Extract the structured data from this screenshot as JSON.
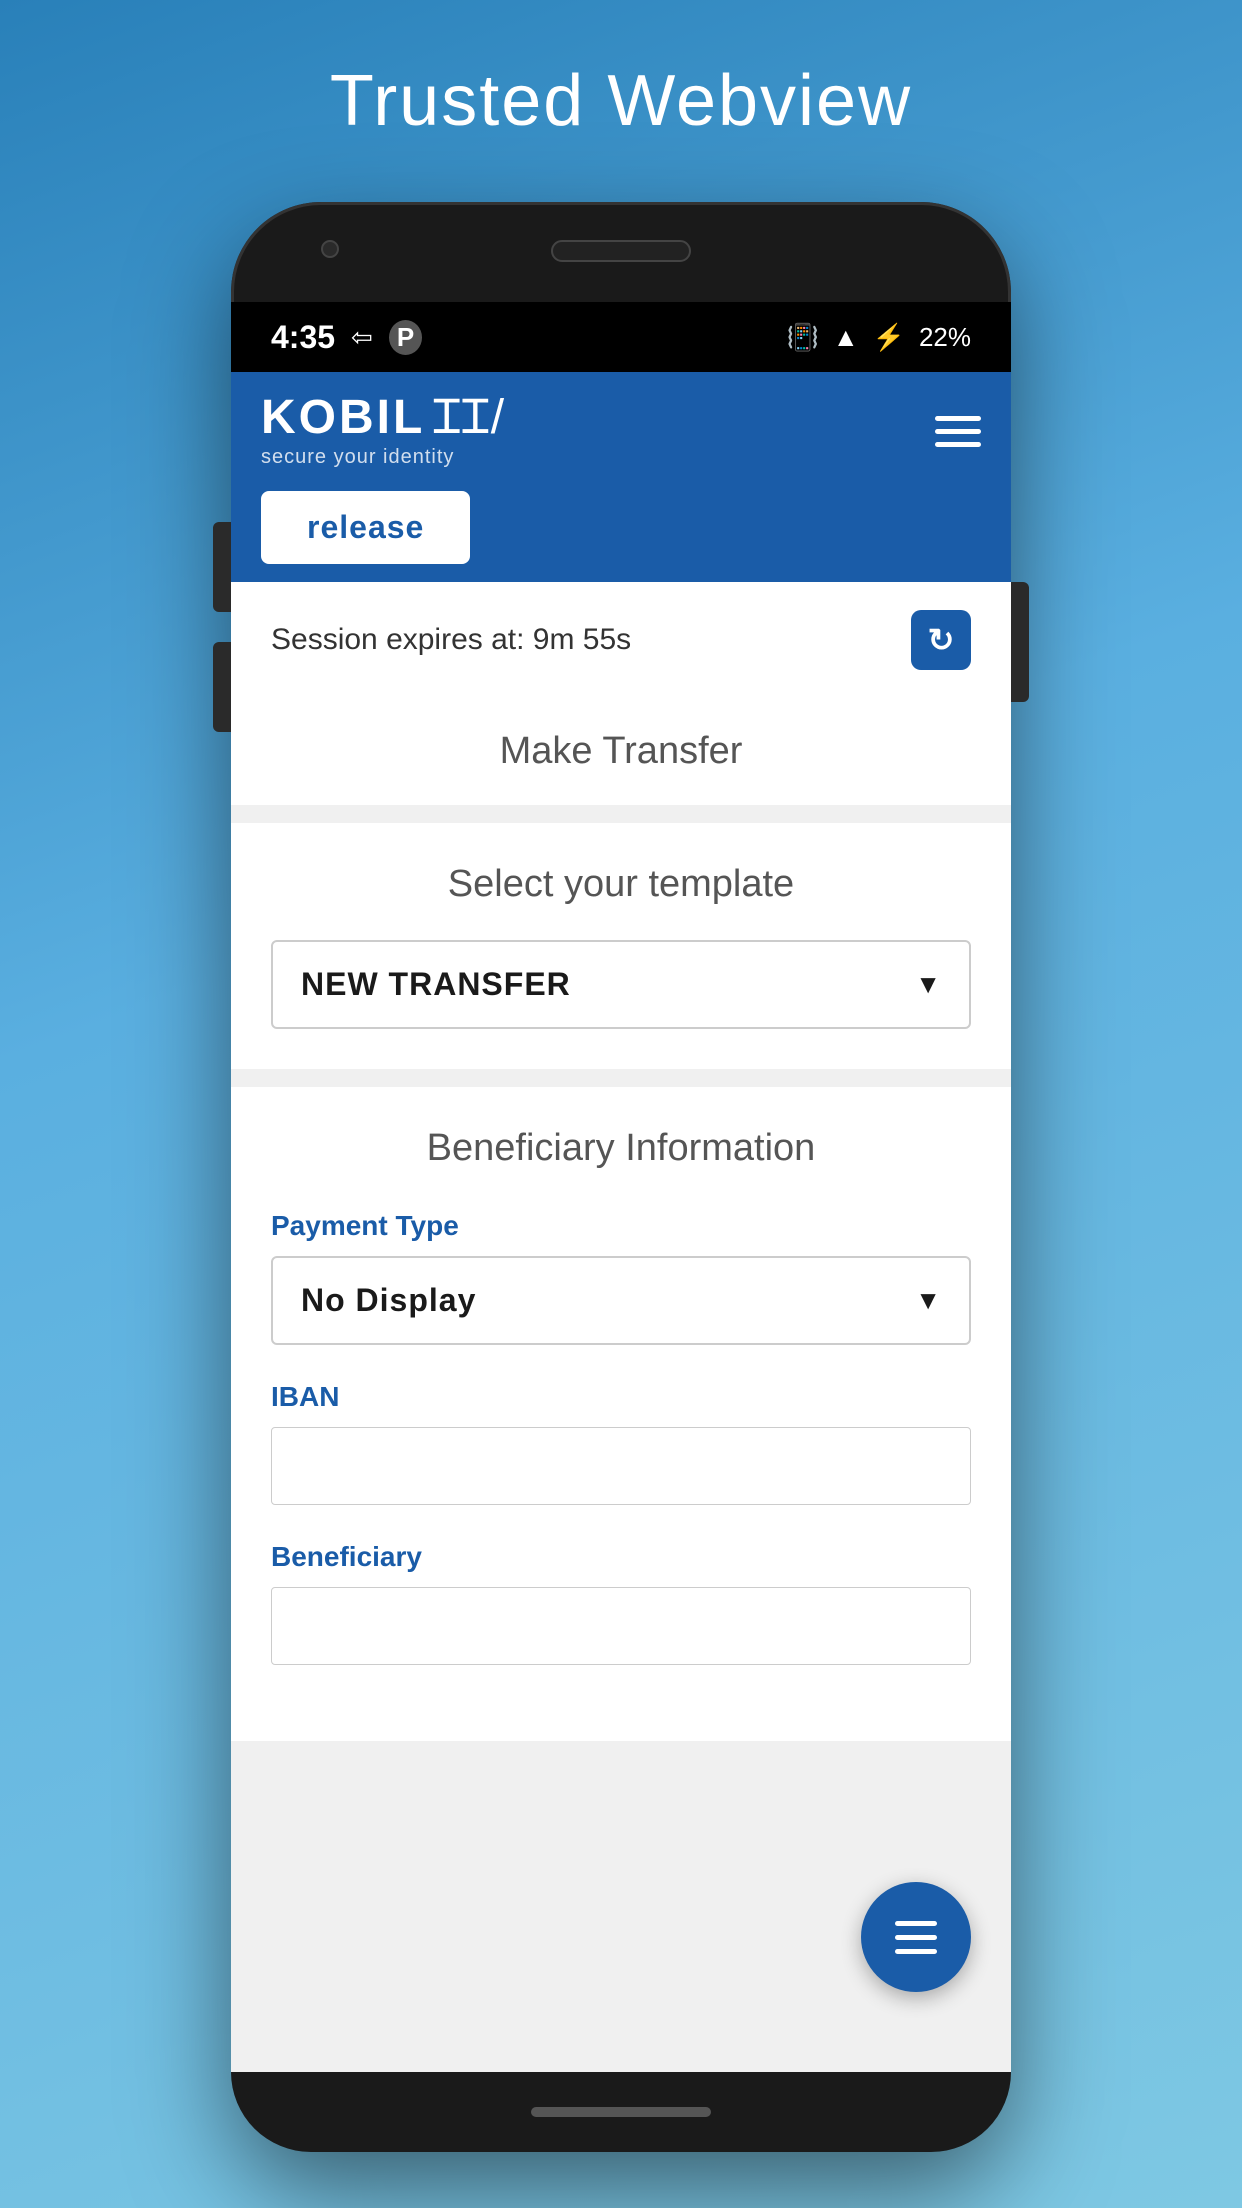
{
  "page": {
    "title": "Trusted Webview"
  },
  "statusBar": {
    "time": "4:35",
    "battery": "22%",
    "icons": [
      "vibrate",
      "wifi",
      "battery"
    ]
  },
  "header": {
    "logo": "KOBIL",
    "tagline": "secure your identity",
    "menuIcon": "☰"
  },
  "releaseBadge": {
    "label": "release"
  },
  "session": {
    "text": "Session expires at: 9m 55s",
    "refreshIcon": "↻"
  },
  "makeTransfer": {
    "title": "Make Transfer"
  },
  "templateSection": {
    "label": "Select your template",
    "dropdown": {
      "value": "NEW TRANSFER",
      "arrow": "▼"
    }
  },
  "beneficiarySection": {
    "title": "Beneficiary Information",
    "fields": [
      {
        "label": "Payment Type",
        "type": "dropdown",
        "value": "No Display",
        "arrow": "▼"
      },
      {
        "label": "IBAN",
        "type": "input",
        "value": "",
        "placeholder": ""
      },
      {
        "label": "Beneficiary",
        "type": "input",
        "value": "",
        "placeholder": ""
      }
    ]
  },
  "fab": {
    "icon": "menu"
  }
}
